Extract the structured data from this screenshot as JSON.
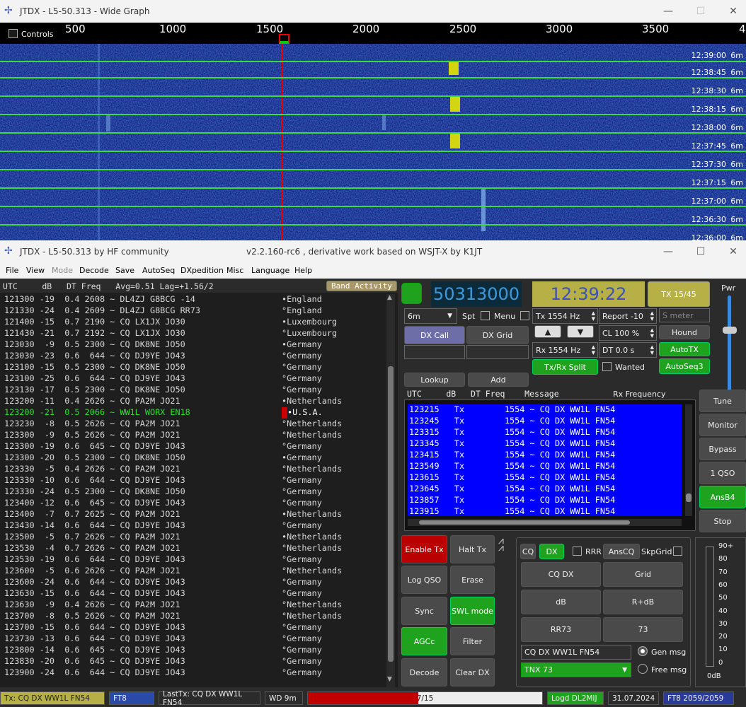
{
  "wide_graph": {
    "title": "JTDX - L5-50.313 - Wide Graph",
    "controls_label": "Controls",
    "scale_ticks": [
      "500",
      "1000",
      "1500",
      "2000",
      "2500",
      "3000",
      "3500",
      "4"
    ],
    "timestamps": [
      "12:39:00",
      "12:38:45",
      "12:38:30",
      "12:38:15",
      "12:38:00",
      "12:37:45",
      "12:37:30",
      "12:37:15",
      "12:37:00",
      "12:36:30",
      "12:36:00"
    ],
    "band": "6m"
  },
  "main": {
    "title": "JTDX - L5-50.313  by HF community",
    "version": "v2.2.160-rc6 , derivative work based on WSJT-X by K1JT"
  },
  "menu": [
    "File",
    "View",
    "Mode",
    "Decode",
    "Save",
    "AutoSeq",
    "DXpedition",
    "Misc",
    "Language",
    "Help"
  ],
  "decode_header": {
    "text": "UTC     dB   DT Freq   Avg=0.51 Lag=+1.56/2",
    "band_activity": "Band Activity"
  },
  "decodes": [
    {
      "t": "121300 -19  0.4 2608 ~ DL4ZJ G8BCG -14",
      "c": "•England"
    },
    {
      "t": "121330 -24  0.4 2609 ~ DL4ZJ G8BCG RR73",
      "c": "°England"
    },
    {
      "t": "121400 -15  0.7 2190 ~ CQ LX1JX JO30",
      "c": "•Luxembourg"
    },
    {
      "t": "121430 -21  0.7 2192 ~ CQ LX1JX JO30",
      "c": "°Luxembourg"
    },
    {
      "t": "123030  -9  0.5 2300 ~ CQ DK8NE JO50",
      "c": "•Germany"
    },
    {
      "t": "123030 -23  0.6  644 ~ CQ DJ9YE JO43",
      "c": "°Germany"
    },
    {
      "t": "123100 -15  0.5 2300 ~ CQ DK8NE JO50",
      "c": "°Germany"
    },
    {
      "t": "123100 -25  0.6  644 ~ CQ DJ9YE JO43",
      "c": "°Germany"
    },
    {
      "t": "123130 -17  0.5 2300 ~ CQ DK8NE JO50",
      "c": "°Germany"
    },
    {
      "t": "123200 -11  0.4 2626 ~ CQ PA2M JO21",
      "c": "•Netherlands"
    },
    {
      "t": "123200 -21  0.5 2066 ~ WW1L WORX EN18",
      "c": "•U.S.A.",
      "hl": true
    },
    {
      "t": "123230  -8  0.5 2626 ~ CQ PA2M JO21",
      "c": "°Netherlands"
    },
    {
      "t": "123300  -9  0.5 2626 ~ CQ PA2M JO21",
      "c": "°Netherlands"
    },
    {
      "t": "123300 -19  0.6  645 ~ CQ DJ9YE JO43",
      "c": "°Germany"
    },
    {
      "t": "123300 -20  0.5 2300 ~ CQ DK8NE JO50",
      "c": "•Germany"
    },
    {
      "t": "123330  -5  0.4 2626 ~ CQ PA2M JO21",
      "c": "°Netherlands"
    },
    {
      "t": "123330 -10  0.6  644 ~ CQ DJ9YE JO43",
      "c": "°Germany"
    },
    {
      "t": "123330 -24  0.5 2300 ~ CQ DK8NE JO50",
      "c": "°Germany"
    },
    {
      "t": "123400 -12  0.6  645 ~ CQ DJ9YE JO43",
      "c": "°Germany"
    },
    {
      "t": "123400  -7  0.7 2625 ~ CQ PA2M JO21",
      "c": "•Netherlands"
    },
    {
      "t": "123430 -14  0.6  644 ~ CQ DJ9YE JO43",
      "c": "°Germany"
    },
    {
      "t": "123500  -5  0.7 2626 ~ CQ PA2M JO21",
      "c": "•Netherlands"
    },
    {
      "t": "123530  -4  0.7 2626 ~ CQ PA2M JO21",
      "c": "°Netherlands"
    },
    {
      "t": "123530 -19  0.6  644 ~ CQ DJ9YE JO43",
      "c": "°Germany"
    },
    {
      "t": "123600  -5  0.6 2626 ~ CQ PA2M JO21",
      "c": "°Netherlands"
    },
    {
      "t": "123600 -24  0.6  644 ~ CQ DJ9YE JO43",
      "c": "°Germany"
    },
    {
      "t": "123630 -15  0.6  644 ~ CQ DJ9YE JO43",
      "c": "°Germany"
    },
    {
      "t": "123630  -9  0.4 2626 ~ CQ PA2M JO21",
      "c": "°Netherlands"
    },
    {
      "t": "123700  -8  0.5 2626 ~ CQ PA2M JO21",
      "c": "°Netherlands"
    },
    {
      "t": "123700 -15  0.6  644 ~ CQ DJ9YE JO43",
      "c": "°Germany"
    },
    {
      "t": "123730 -13  0.6  644 ~ CQ DJ9YE JO43",
      "c": "°Germany"
    },
    {
      "t": "123800 -14  0.6  645 ~ CQ DJ9YE JO43",
      "c": "°Germany"
    },
    {
      "t": "123830 -20  0.6  645 ~ CQ DJ9YE JO43",
      "c": "°Germany"
    },
    {
      "t": "123900 -24  0.6  644 ~ CQ DJ9YE JO43",
      "c": "°Germany"
    }
  ],
  "freq": "50313000",
  "clock": "12:39:22",
  "tx_period": "TX 15/45",
  "pwr": "Pwr",
  "band_select": "6m",
  "spt": "Spt",
  "menu_chk": "Menu",
  "tx_hz": "Tx  1554  Hz",
  "report": "Report -10",
  "smeter": "S meter",
  "dx_call": "DX Call",
  "dx_grid": "DX Grid",
  "cl": "CL  100 %",
  "hound": "Hound",
  "rx_hz": "Rx  1554  Hz",
  "dt": "DT 0.0 s",
  "autotx": "AutoTX",
  "txrx_split": "Tx/Rx Split",
  "wanted": "Wanted",
  "autoseq3": "AutoSeq3",
  "lookup": "Lookup",
  "add": "Add",
  "rx_header": {
    "a": "UTC     dB   DT Freq    Message",
    "b": "Rx Frequency"
  },
  "rx_rows": [
    "123215   Tx        1554 ~ CQ DX WW1L FN54",
    "123245   Tx        1554 ~ CQ DX WW1L FN54",
    "123315   Tx        1554 ~ CQ DX WW1L FN54",
    "123345   Tx        1554 ~ CQ DX WW1L FN54",
    "123415   Tx        1554 ~ CQ DX WW1L FN54",
    "123549   Tx        1554 ~ CQ DX WW1L FN54",
    "123615   Tx        1554 ~ CQ DX WW1L FN54",
    "123645   Tx        1554 ~ CQ DX WW1L FN54",
    "123857   Tx        1554 ~ CQ DX WW1L FN54",
    "123915   Tx        1554 ~ CQ DX WW1L FN54"
  ],
  "side_buttons": [
    "Tune",
    "Monitor",
    "Bypass",
    "1 QSO",
    "AnsB4",
    "Stop"
  ],
  "ctrl_buttons": [
    "Enable Tx",
    "Halt Tx",
    "Log QSO",
    "Erase",
    "Sync",
    "SWL mode",
    "AGCc",
    "Filter",
    "Decode",
    "Clear DX"
  ],
  "msg": {
    "cq": "CQ",
    "dx": "DX",
    "rrr": "RRR",
    "anscq": "AnsCQ",
    "skpgrid": "SkpGrid",
    "cqdx": "CQ DX",
    "grid": "Grid",
    "db": "dB",
    "rdb": "R+dB",
    "rr73": "RR73",
    "s73": "73",
    "gen_text": "CQ DX WW1L FN54",
    "gen_msg": "Gen msg",
    "tnx": "TNX 73",
    "free_msg": "Free msg"
  },
  "meter_ticks": [
    "90+",
    "80",
    "70",
    "60",
    "50",
    "40",
    "30",
    "20",
    "10",
    "0"
  ],
  "meter_db": "0dB",
  "status": {
    "tx": "Tx: CQ DX WW1L FN54",
    "mode": "FT8",
    "lasttx": "LastTx: CQ DX WW1L FN54",
    "wd": "WD 9m",
    "progress": "7/15",
    "progress_fraction": 0.47,
    "logd": "Logd DL2MIJ",
    "date": "31.07.2024",
    "count": "FT8  2059/2059"
  }
}
